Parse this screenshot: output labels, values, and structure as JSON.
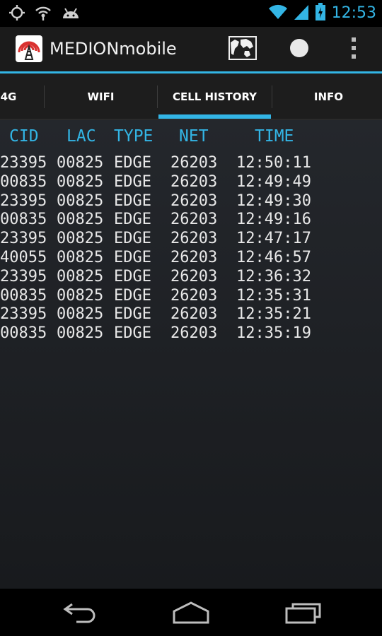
{
  "status_bar": {
    "time": "12:53",
    "left_icons": [
      "gps-icon",
      "wifi-hotspot-icon",
      "android-debug-icon"
    ],
    "right_icons": [
      "wifi-signal-icon",
      "cell-signal-icon",
      "battery-icon"
    ]
  },
  "action_bar": {
    "title": "MEDION​mobile",
    "icons": [
      "app-logo-icon",
      "map-icon",
      "record-icon",
      "overflow-menu-icon"
    ]
  },
  "tabs": [
    {
      "label": "4G",
      "active": false
    },
    {
      "label": "WIFI",
      "active": false
    },
    {
      "label": "CELL HISTORY",
      "active": true
    },
    {
      "label": "INFO",
      "active": false
    }
  ],
  "table": {
    "headers": [
      "CID",
      "LAC",
      "TYPE",
      "NET",
      "TIME"
    ],
    "rows": [
      [
        "23395",
        "00825",
        "EDGE",
        "26203",
        "12:50:11"
      ],
      [
        "00835",
        "00825",
        "EDGE",
        "26203",
        "12:49:49"
      ],
      [
        "23395",
        "00825",
        "EDGE",
        "26203",
        "12:49:30"
      ],
      [
        "00835",
        "00825",
        "EDGE",
        "26203",
        "12:49:16"
      ],
      [
        "23395",
        "00825",
        "EDGE",
        "26203",
        "12:47:17"
      ],
      [
        "40055",
        "00825",
        "EDGE",
        "26203",
        "12:46:57"
      ],
      [
        "23395",
        "00825",
        "EDGE",
        "26203",
        "12:36:32"
      ],
      [
        "00835",
        "00825",
        "EDGE",
        "26203",
        "12:35:31"
      ],
      [
        "23395",
        "00825",
        "EDGE",
        "26203",
        "12:35:21"
      ],
      [
        "00835",
        "00825",
        "EDGE",
        "26203",
        "12:35:19"
      ]
    ]
  },
  "nav_bar": {
    "icons": [
      "back-icon",
      "home-icon",
      "recents-icon"
    ]
  },
  "colors": {
    "accent": "#33b5e5",
    "text": "#e8e8e8",
    "background": "#1f2226"
  }
}
